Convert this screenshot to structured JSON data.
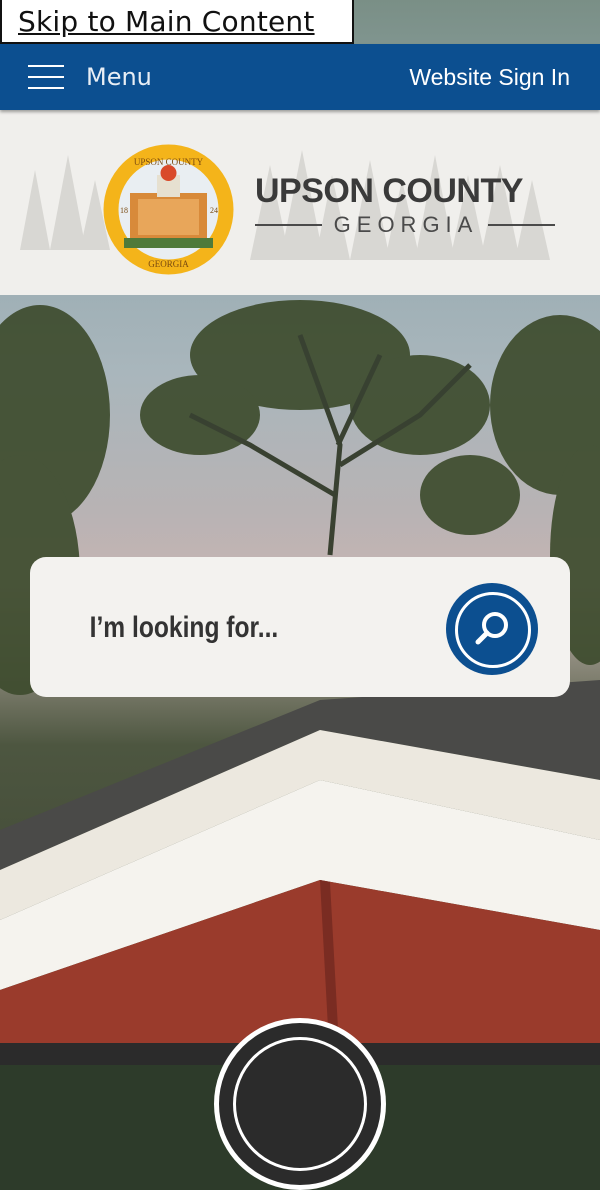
{
  "skip_link": {
    "label": "Skip to Main Content"
  },
  "topbar": {
    "menu_label": "Menu",
    "signin_label": "Website Sign In",
    "bg_color": "#0c4f90"
  },
  "logo": {
    "title": "UPSON COUNTY",
    "subtitle": "GEORGIA",
    "seal_top_text": "UPSON COUNTY",
    "seal_bottom_text": "GEORGIA",
    "seal_year_left": "18",
    "seal_year_right": "24"
  },
  "search": {
    "placeholder": "I’m looking for..."
  }
}
